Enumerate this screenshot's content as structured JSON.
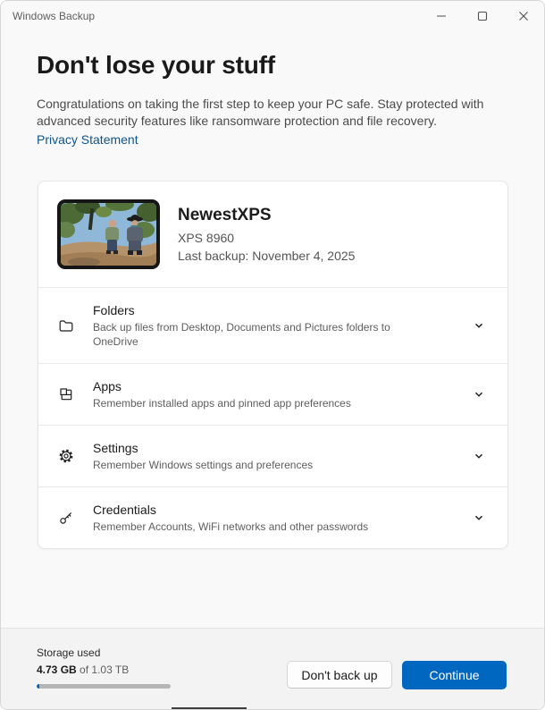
{
  "window": {
    "title": "Windows Backup",
    "controls": {
      "minimize": "minimize",
      "maximize": "maximize",
      "close": "close"
    }
  },
  "header": {
    "title": "Don't lose your stuff",
    "description": "Congratulations on taking the first step to keep your PC safe. Stay protected with advanced security features like ransomware protection and file recovery.",
    "privacy_link": "Privacy Statement"
  },
  "device": {
    "name": "NewestXPS",
    "model": "XPS 8960",
    "last_backup": "Last backup: November 4, 2025"
  },
  "backup_items": [
    {
      "icon": "folder-icon",
      "title": "Folders",
      "description": "Back up files from Desktop, Documents and Pictures folders to OneDrive"
    },
    {
      "icon": "apps-icon",
      "title": "Apps",
      "description": "Remember installed apps and pinned app preferences"
    },
    {
      "icon": "gear-icon",
      "title": "Settings",
      "description": "Remember Windows settings and preferences"
    },
    {
      "icon": "key-icon",
      "title": "Credentials",
      "description": "Remember Accounts, WiFi networks and other passwords"
    }
  ],
  "footer": {
    "storage_label": "Storage used",
    "storage_used": "4.73 GB",
    "storage_of": " of ",
    "storage_total": "1.03 TB",
    "progress_percent": 0.45,
    "dont_back_up_label": "Don't back up",
    "continue_label": "Continue"
  },
  "colors": {
    "accent": "#0067c0",
    "link": "#0f548c",
    "progress_track": "#b5b5b5"
  }
}
